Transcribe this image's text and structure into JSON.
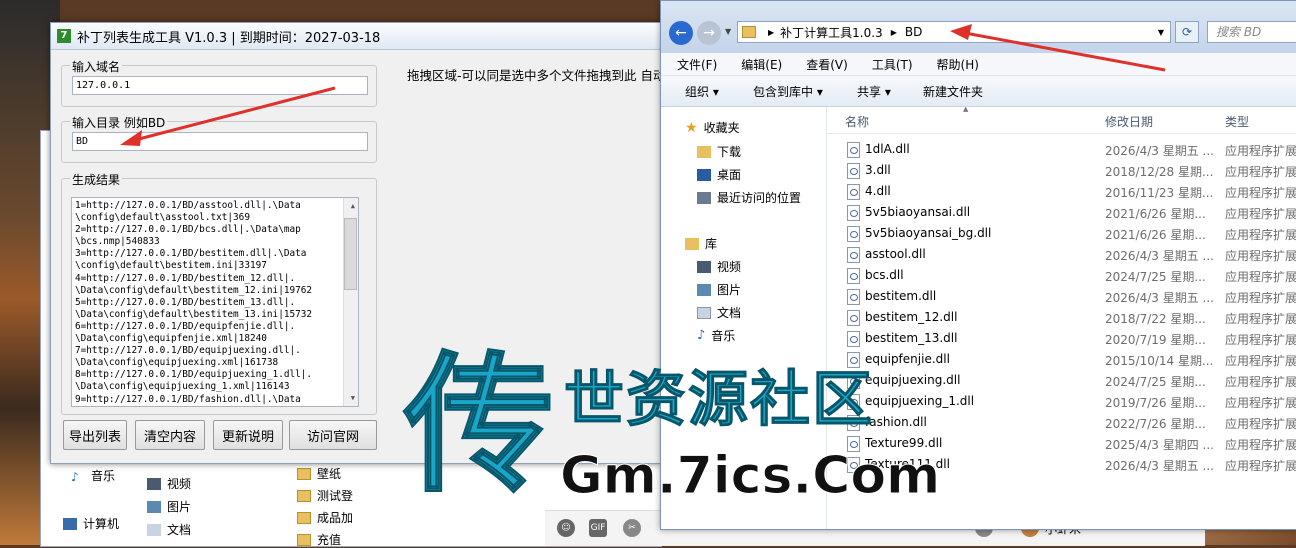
{
  "tool": {
    "logo": "7",
    "title": "补丁列表生成工具 V1.0.3 | 到期时间：2027-03-18",
    "domain_label": "输入域名",
    "domain_value": "127.0.0.1",
    "dir_label": "输入目录 例如BD",
    "dir_value": "BD",
    "result_label": "生成结果",
    "result_lines": [
      "1=http://127.0.0.1/BD/asstool.dll|.\\Data",
      "\\config\\default\\asstool.txt|369",
      "2=http://127.0.0.1/BD/bcs.dll|.\\Data\\map",
      "\\bcs.nmp|540833",
      "3=http://127.0.0.1/BD/bestitem.dll|.\\Data",
      "\\config\\default\\bestitem.ini|33197",
      "4=http://127.0.0.1/BD/bestitem_12.dll|.",
      "\\Data\\config\\default\\bestitem_12.ini|19762",
      "5=http://127.0.0.1/BD/bestitem_13.dll|.",
      "\\Data\\config\\default\\bestitem_13.ini|15732",
      "6=http://127.0.0.1/BD/equipfenjie.dll|.",
      "\\Data\\config\\equipfenjie.xml|18240",
      "7=http://127.0.0.1/BD/equipjuexing.dll|.",
      "\\Data\\config\\equipjuexing.xml|161738",
      "8=http://127.0.0.1/BD/equipjuexing_1.dll|.",
      "\\Data\\config\\equipjuexing_1.xml|116143",
      "9=http://127.0.0.1/BD/fashion.dll|.\\Data"
    ],
    "drop_hint": "拖拽区域-可以同是选中多个文件拖拽到此 自动",
    "buttons": [
      "导出列表",
      "清空内容",
      "更新说明",
      "访问官网"
    ]
  },
  "explorer": {
    "breadcrumb": [
      "补丁计算工具1.0.3",
      "BD"
    ],
    "search_placeholder": "搜索 BD",
    "menu": [
      "文件(F)",
      "编辑(E)",
      "查看(V)",
      "工具(T)",
      "帮助(H)"
    ],
    "commands": [
      "组织 ▾",
      "包含到库中 ▾",
      "共享 ▾",
      "新建文件夹"
    ],
    "nav": {
      "favorites": "收藏夹",
      "fav_items": [
        "下载",
        "桌面",
        "最近访问的位置"
      ],
      "libraries": "库",
      "lib_items": [
        "视频",
        "图片",
        "文档",
        "音乐"
      ]
    },
    "columns": [
      "名称",
      "修改日期",
      "类型"
    ],
    "files": [
      {
        "name": "1dlA.dll",
        "date": "2026/4/3 星期五 ...",
        "type": "应用程序扩展"
      },
      {
        "name": "3.dll",
        "date": "2018/12/28 星期...",
        "type": "应用程序扩展"
      },
      {
        "name": "4.dll",
        "date": "2016/11/23 星期...",
        "type": "应用程序扩展"
      },
      {
        "name": "5v5biaoyansai.dll",
        "date": "2021/6/26 星期...",
        "type": "应用程序扩展"
      },
      {
        "name": "5v5biaoyansai_bg.dll",
        "date": "2021/6/26 星期...",
        "type": "应用程序扩展"
      },
      {
        "name": "asstool.dll",
        "date": "2026/4/3 星期五 ...",
        "type": "应用程序扩展"
      },
      {
        "name": "bcs.dll",
        "date": "2024/7/25 星期...",
        "type": "应用程序扩展"
      },
      {
        "name": "bestitem.dll",
        "date": "2026/4/3 星期五 ...",
        "type": "应用程序扩展"
      },
      {
        "name": "bestitem_12.dll",
        "date": "2018/7/22 星期...",
        "type": "应用程序扩展"
      },
      {
        "name": "bestitem_13.dll",
        "date": "2020/7/19 星期...",
        "type": "应用程序扩展"
      },
      {
        "name": "equipfenjie.dll",
        "date": "2015/10/14 星期...",
        "type": "应用程序扩展"
      },
      {
        "name": "equipjuexing.dll",
        "date": "2024/7/25 星期...",
        "type": "应用程序扩展"
      },
      {
        "name": "equipjuexing_1.dll",
        "date": "2019/7/26 星期...",
        "type": "应用程序扩展"
      },
      {
        "name": "fashion.dll",
        "date": "2022/7/26 星期...",
        "type": "应用程序扩展"
      },
      {
        "name": "Texture99.dll",
        "date": "2025/4/3 星期四 ...",
        "type": "应用程序扩展"
      },
      {
        "name": "Texture111.dll",
        "date": "2026/4/3 星期五 ...",
        "type": "应用程序扩展"
      }
    ]
  },
  "background": {
    "under_nav": [
      "音乐",
      "计算机"
    ],
    "under_items": [
      "视频",
      "图片",
      "文档"
    ],
    "under_folders": [
      "壁纸",
      "测试登",
      "成品加",
      "充值"
    ],
    "chat_user": "小虾米",
    "chat_gif": "GIF"
  },
  "watermark": {
    "big_char": "传",
    "line1": "世资源社区",
    "line2": "Gm.7ics.Com",
    "color_primary": "#1aa6c8",
    "color_secondary": "#111111"
  },
  "colors": {
    "arrow": "#e0302a",
    "title_bar": "#dfe8f3"
  }
}
